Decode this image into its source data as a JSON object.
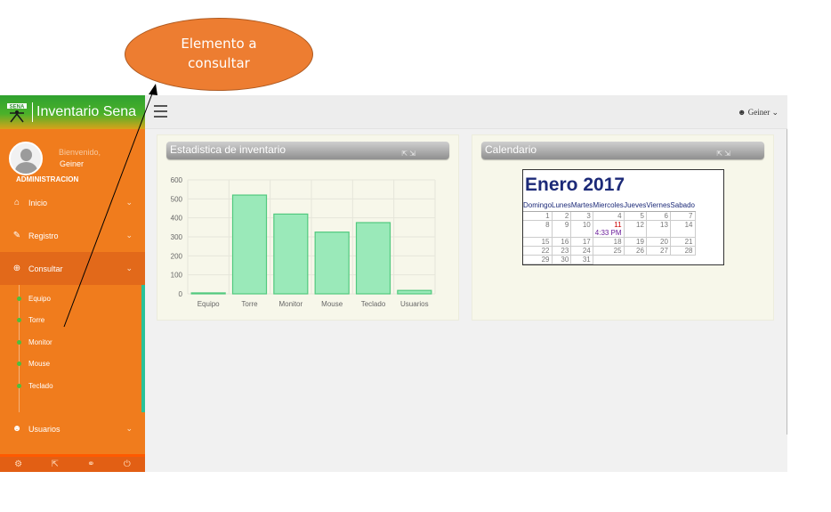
{
  "callout": {
    "line1": "Elemento a",
    "line2": "consultar"
  },
  "sidebar": {
    "brand": "Inventario Sena",
    "welcome": "Bienvenido,",
    "username": "Geiner",
    "role": "ADMINISTRACION",
    "items": [
      {
        "label": "Inicio",
        "icon": "home-icon"
      },
      {
        "label": "Registro",
        "icon": "edit-icon"
      },
      {
        "label": "Consultar",
        "icon": "search-plus-icon"
      },
      {
        "label": "Usuarios",
        "icon": "users-icon"
      }
    ],
    "subitems": [
      "Equipo",
      "Torre",
      "Monitor",
      "Mouse",
      "Teclado"
    ],
    "footer_icons": [
      "gear-icon",
      "fullscreen-icon",
      "eye-slash-icon",
      "power-icon"
    ]
  },
  "topbar": {
    "user": "Geiner"
  },
  "stats_panel": {
    "title": "Estadistica de inventario"
  },
  "calendar_panel": {
    "title": "Calendario"
  },
  "chart_data": {
    "type": "bar",
    "categories": [
      "Equipo",
      "Torre",
      "Monitor",
      "Mouse",
      "Teclado",
      "Usuarios"
    ],
    "values": [
      5,
      520,
      420,
      325,
      375,
      18
    ],
    "ylim": [
      0,
      600
    ],
    "yticks": [
      0,
      100,
      200,
      300,
      400,
      500,
      600
    ],
    "grid": true,
    "bar_fill": "#9ae9b9",
    "bar_stroke": "#52c97e"
  },
  "calendar": {
    "title": "Enero 2017",
    "days": [
      "Domingo",
      "Lunes",
      "Martes",
      "Miercoles",
      "Jueves",
      "Viernes",
      "Sabado"
    ],
    "weeks": [
      [
        "1",
        "2",
        "3",
        "4",
        "5",
        "6",
        "7"
      ],
      [
        "8",
        "9",
        "10",
        "11",
        "12",
        "13",
        "14"
      ],
      [
        "15",
        "16",
        "17",
        "18",
        "19",
        "20",
        "21"
      ],
      [
        "22",
        "23",
        "24",
        "25",
        "26",
        "27",
        "28"
      ],
      [
        "29",
        "30",
        "31",
        "",
        "",
        "",
        ""
      ]
    ],
    "today": "11",
    "event_time": "4:33 PM"
  }
}
